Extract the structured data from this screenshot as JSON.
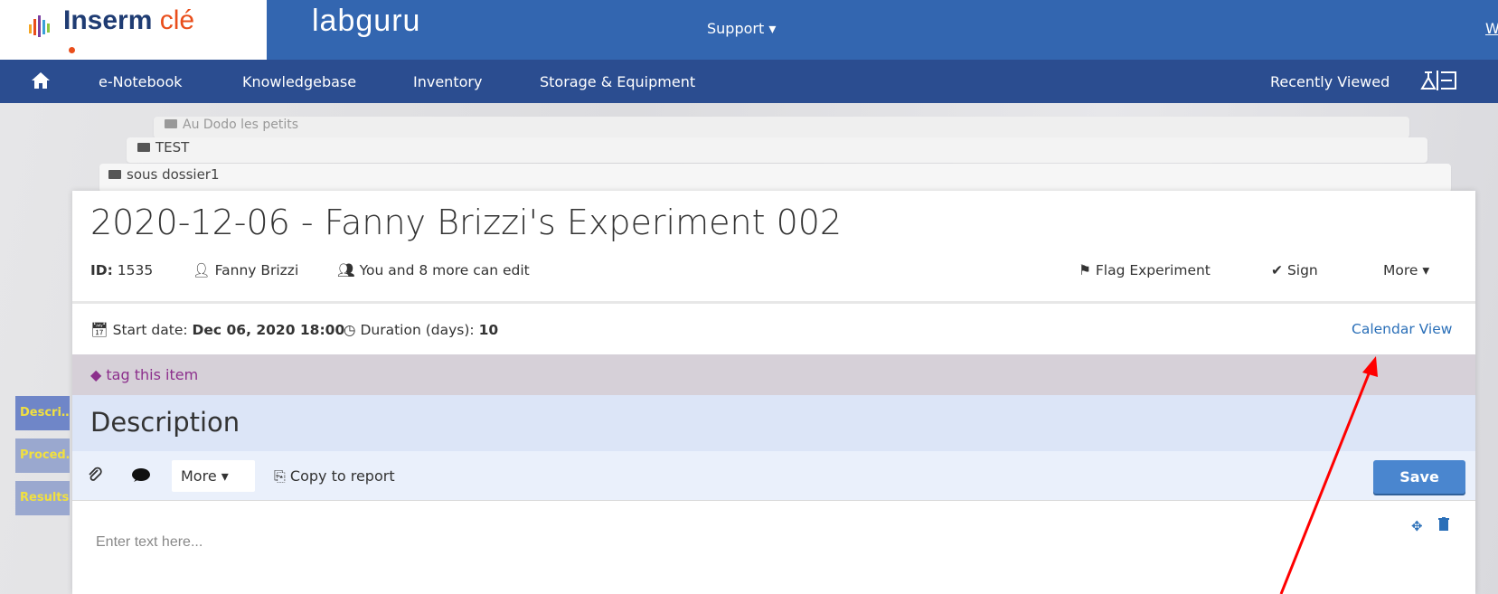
{
  "header": {
    "brand_main": "Inserm",
    "brand_suffix": "clé",
    "app_logo": "labguru",
    "support_label": "Support ▾",
    "right_link": "W"
  },
  "nav": {
    "items": [
      "e-Notebook",
      "Knowledgebase",
      "Inventory",
      "Storage & Equipment"
    ],
    "recently_viewed": "Recently Viewed"
  },
  "breadcrumb": {
    "level1": "Au Dodo les petits",
    "level2": "TEST",
    "level3": "sous dossier1"
  },
  "experiment": {
    "title": "2020-12-06 - Fanny Brizzi's Experiment 002",
    "id_label": "ID:",
    "id_value": "1535",
    "owner": "Fanny Brizzi",
    "editors": "You and 8 more can edit",
    "flag_label": "Flag Experiment",
    "sign_label": "Sign",
    "more_label": "More"
  },
  "dates": {
    "start_label": "Start date:",
    "start_value": "Dec 06, 2020 18:00",
    "duration_label": "Duration (days):",
    "duration_value": "10",
    "calendar_view": "Calendar View"
  },
  "tags": {
    "tag_link": "tag this item"
  },
  "section": {
    "title": "Description",
    "more_label": "More",
    "copy_label": "Copy to report",
    "save_label": "Save",
    "editor_placeholder": "Enter text here..."
  },
  "sidetabs": [
    "Descri…",
    "Proced…",
    "Results"
  ],
  "colors": {
    "topbar": "#3366b0",
    "navbar": "#2b4d90",
    "link": "#2a6fb8",
    "tag": "#8c2f8c",
    "save": "#4a86cf",
    "annotation_arrow": "#ff0000"
  }
}
